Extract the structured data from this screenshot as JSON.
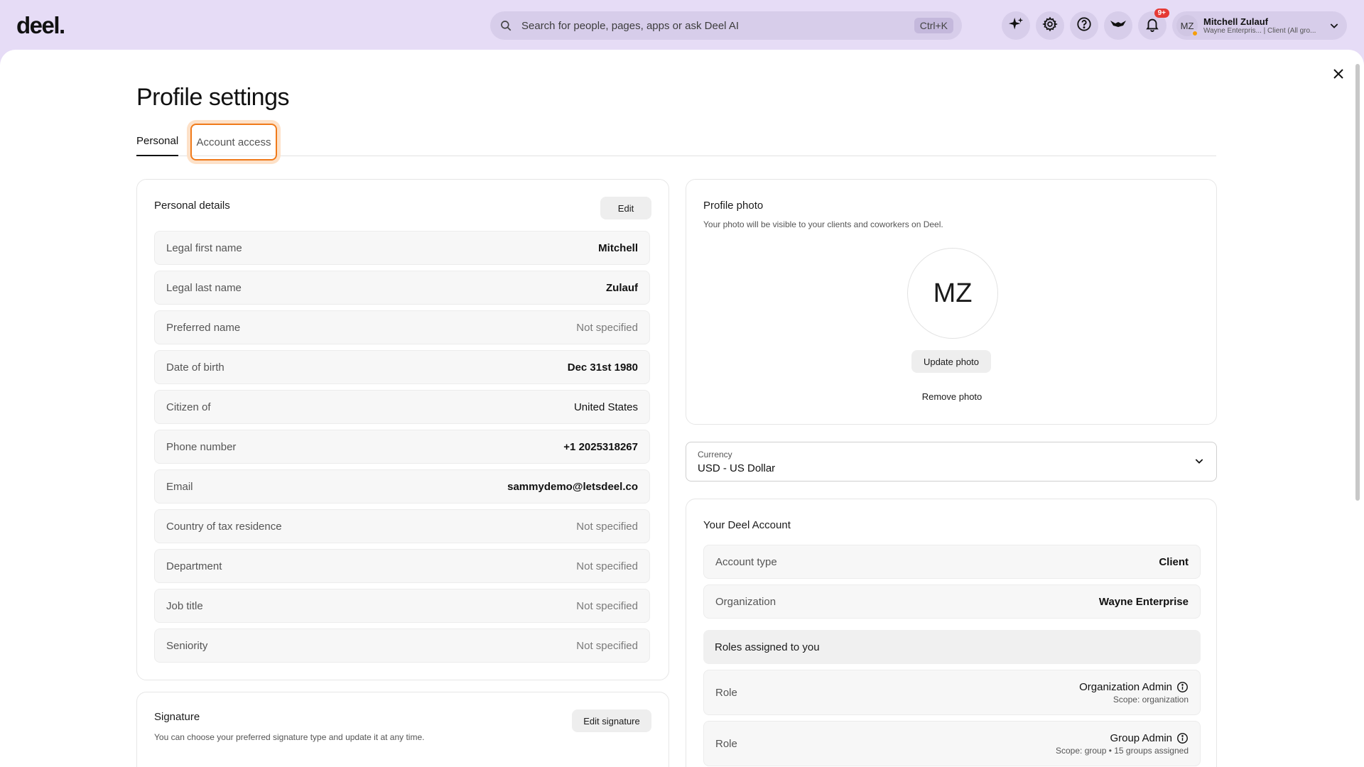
{
  "topbar": {
    "logo": "deel.",
    "search_placeholder": "Search for people, pages, apps or ask Deel AI",
    "search_shortcut": "Ctrl+K",
    "notifications_badge": "9+",
    "user": {
      "initials": "MZ",
      "name": "Mitchell Zulauf",
      "org_line": "Wayne Enterpris... | Client (All gro..."
    }
  },
  "page": {
    "title": "Profile settings",
    "tabs": [
      {
        "label": "Personal",
        "active": true
      },
      {
        "label": "Account access",
        "active": false
      }
    ]
  },
  "personal_details": {
    "title": "Personal details",
    "edit_label": "Edit",
    "rows": [
      {
        "label": "Legal first name",
        "value": "Mitchell"
      },
      {
        "label": "Legal last name",
        "value": "Zulauf"
      },
      {
        "label": "Preferred name",
        "value": "Not specified"
      },
      {
        "label": "Date of birth",
        "value": "Dec 31st 1980"
      },
      {
        "label": "Citizen of",
        "value": "United States"
      },
      {
        "label": "Phone number",
        "value": "+1 2025318267"
      },
      {
        "label": "Email",
        "value": "sammydemo@letsdeel.co"
      },
      {
        "label": "Country of tax residence",
        "value": "Not specified"
      },
      {
        "label": "Department",
        "value": "Not specified"
      },
      {
        "label": "Job title",
        "value": "Not specified"
      },
      {
        "label": "Seniority",
        "value": "Not specified"
      }
    ]
  },
  "signature": {
    "title": "Signature",
    "edit_label": "Edit signature",
    "description": "You can choose your preferred signature type and update it at any time."
  },
  "profile_photo": {
    "title": "Profile photo",
    "description": "Your photo will be visible to your clients and coworkers on Deel.",
    "initials": "MZ",
    "update_label": "Update photo",
    "remove_label": "Remove photo"
  },
  "currency": {
    "label": "Currency",
    "value": "USD - US Dollar"
  },
  "deel_account": {
    "title": "Your Deel Account",
    "account_type_label": "Account type",
    "account_type_value": "Client",
    "organization_label": "Organization",
    "organization_value": "Wayne Enterprise",
    "roles_heading": "Roles assigned to you",
    "roles": [
      {
        "label": "Role",
        "name": "Organization Admin",
        "scope": "Scope: organization"
      },
      {
        "label": "Role",
        "name": "Group Admin",
        "scope": "Scope: group • 15 groups assigned"
      }
    ]
  },
  "colors": {
    "topbar_bg": "#e6dcf6",
    "focus_ring": "#f07a1a",
    "badge": "#e53935"
  }
}
